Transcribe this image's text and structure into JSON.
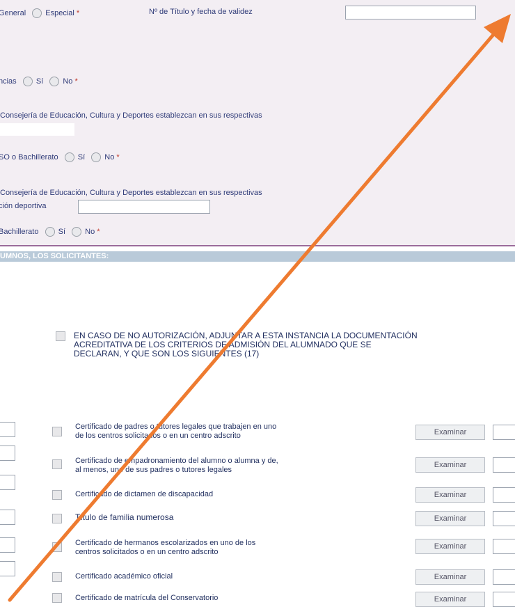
{
  "form": {
    "row1": {
      "opt_general": "General",
      "opt_especial": "Especial",
      "required": "*",
      "title_label": "Nº de Título y fecha de validez",
      "title_value": ""
    },
    "row2": {
      "label": "ncias",
      "yes": "Sí",
      "no": "No",
      "required": "*"
    },
    "row3": {
      "text": "Consejería de Educación, Cultura y Deportes establezcan en sus respectivas"
    },
    "row4": {
      "label": "SO o Bachillerato",
      "yes": "Sí",
      "no": "No",
      "required": "*"
    },
    "row5": {
      "text": "Consejería de Educación, Cultura y Deportes establezcan en sus respectivas"
    },
    "row6": {
      "label": "ción deportiva",
      "value": ""
    },
    "row7": {
      "label": "Bachillerato",
      "yes": "Sí",
      "no": "No",
      "required": "*"
    }
  },
  "section": {
    "title": "UMNOS, LOS SOLICITANTES:"
  },
  "notice": {
    "line1": "EN CASO DE NO AUTORIZACIÓN, ADJUNTAR A ESTA INSTANCIA LA DOCUMENTACIÓN",
    "line2": "ACREDITATIVA DE LOS CRITERIOS DE ADMISIÓN DEL ALUMNADO QUE SE",
    "line3": "DECLARAN, Y QUE SON LOS SIGUIENTES (17)"
  },
  "documents": [
    {
      "line1": "Certificado de padres o tutores legales que trabajen en uno",
      "line2": "de los centros solicitados o en un centro adscrito",
      "browse": "Examinar"
    },
    {
      "line1": "Certificado de empadronamiento del alumno o alumna y de,",
      "line2": "al menos, uno de sus padres o tutores legales",
      "browse": "Examinar"
    },
    {
      "line1": "Certificado de dictamen de discapacidad",
      "line2": "",
      "browse": "Examinar"
    },
    {
      "line1": "Título de familia numerosa",
      "line2": "",
      "browse": "Examinar"
    },
    {
      "line1": "Certificado de hermanos escolarizados en uno de los",
      "line2": "centros solicitados o en un centro adscrito",
      "browse": "Examinar"
    },
    {
      "line1": "Certificado académico oficial",
      "line2": "",
      "browse": "Examinar"
    },
    {
      "line1": "Certificado de matrícula del Conservatorio",
      "line2": "",
      "browse": "Examinar"
    }
  ],
  "colors": {
    "arrow": "#ee7b30",
    "section_bar": "#b9cad9",
    "form_bg": "#f3eef3"
  }
}
